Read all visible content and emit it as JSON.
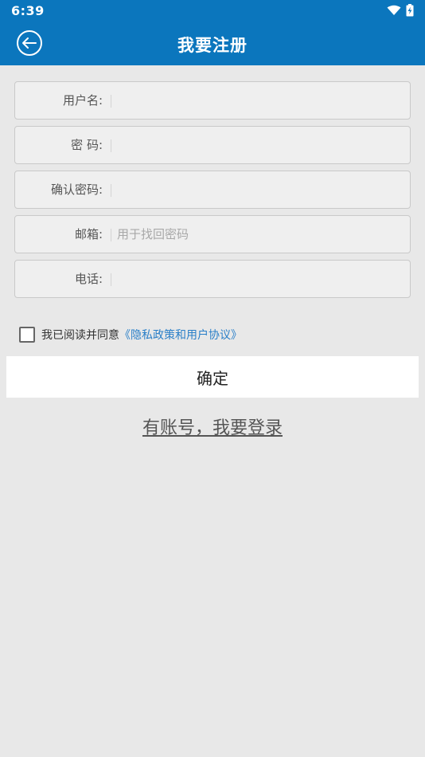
{
  "status_bar": {
    "time": "6:39",
    "wifi_icon": "wifi-icon",
    "battery_icon": "battery-charging-icon"
  },
  "app_bar": {
    "title": "我要注册",
    "back_icon": "back-arrow-icon"
  },
  "form": {
    "fields": [
      {
        "label": "用户名:",
        "value": "",
        "placeholder": ""
      },
      {
        "label": "密 码:",
        "value": "",
        "placeholder": ""
      },
      {
        "label": "确认密码:",
        "value": "",
        "placeholder": ""
      },
      {
        "label": "邮箱:",
        "value": "",
        "placeholder": "用于找回密码"
      },
      {
        "label": "电话:",
        "value": "",
        "placeholder": ""
      }
    ]
  },
  "agreement": {
    "text": "我已阅读并同意",
    "link": "《隐私政策和用户协议》",
    "checked": false
  },
  "confirm_label": "确定",
  "login_link": "有账号，我要登录",
  "colors": {
    "primary": "#0b76bd",
    "link": "#2a7fc8",
    "background": "#e8e8e8"
  }
}
